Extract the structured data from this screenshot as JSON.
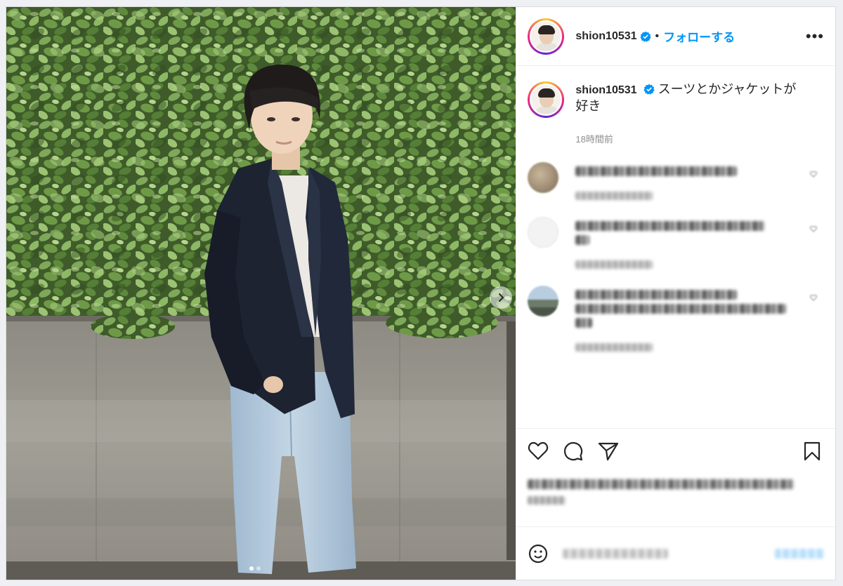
{
  "post": {
    "username": "shion10531",
    "separator": "•",
    "follow_label": "フォローする",
    "more_label": "•••",
    "caption": "スーツとかジャケットが好き",
    "timestamp": "18時間前"
  },
  "carousel": {
    "slide_count": 2,
    "active_index": 0
  },
  "icons": {
    "verified": "verified-badge-icon",
    "like": "heart-icon",
    "comment": "comment-bubble-icon",
    "share": "paper-plane-icon",
    "save": "bookmark-icon",
    "emoji": "emoji-icon",
    "next": "chevron-right-icon"
  },
  "colors": {
    "accent": "#0095f6",
    "text": "#262626",
    "muted": "#8e8e8e",
    "ring_start": "#f9ce34",
    "ring_mid": "#ee2a7b"
  }
}
